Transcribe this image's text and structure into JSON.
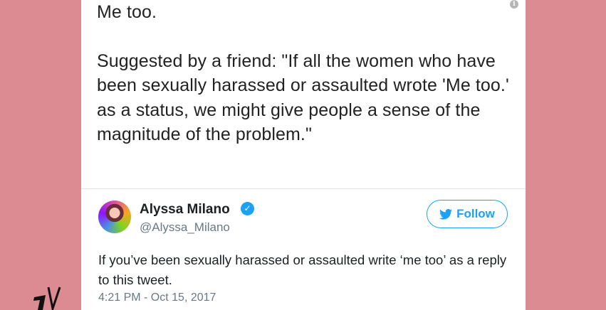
{
  "post": {
    "line1": "Me too.",
    "line2": "Suggested by a friend: \"If all the women who have been sexually harassed or assaulted wrote 'Me too.' as a status, we might give people a sense of the magnitude of the problem.\""
  },
  "tweet": {
    "display_name": "Alyssa Milano",
    "handle": "@Alyssa_Milano",
    "follow_label": "Follow",
    "text": "If you’ve been sexually harassed or assaulted write ‘me too’ as a reply to this tweet.",
    "timestamp": "4:21 PM - Oct 15, 2017"
  },
  "icons": {
    "info": "info-icon",
    "verified": "verified-badge-icon",
    "follow": "twitter-bird-icon",
    "logo": "channel-logo"
  },
  "colors": {
    "background": "#dc8b92",
    "card": "#ffffff",
    "twitter_blue": "#1da1f2",
    "secondary_text": "#697882"
  }
}
